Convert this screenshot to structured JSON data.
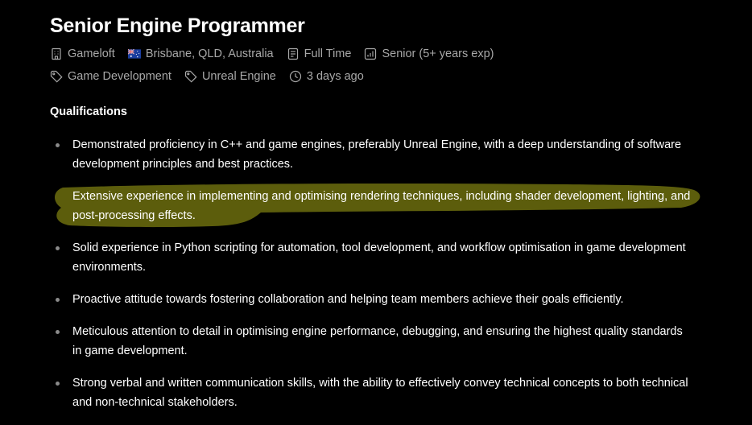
{
  "job": {
    "title": "Senior Engine Programmer",
    "company": "Gameloft",
    "location": "Brisbane, QLD, Australia",
    "employment_type": "Full Time",
    "level": "Senior (5+ years exp)",
    "tags": [
      "Game Development",
      "Unreal Engine"
    ],
    "posted": "3 days ago"
  },
  "icons": {
    "company": "building-icon",
    "location": "australia-flag-icon",
    "employment_type": "document-icon",
    "level": "bar-chart-icon",
    "tag": "tag-icon",
    "posted": "clock-icon"
  },
  "qualifications": {
    "heading": "Qualifications",
    "items": [
      "Demonstrated proficiency in C++ and game engines, preferably Unreal Engine, with a deep understanding of software development principles and best practices.",
      "Extensive experience in implementing and optimising rendering techniques, including shader development, lighting, and post-processing effects.",
      "Solid experience in Python scripting for automation, tool development, and workflow optimisation in game development environments.",
      "Proactive attitude towards fostering collaboration and helping team members achieve their goals efficiently.",
      "Meticulous attention to detail in optimising engine performance, debugging, and ensuring the highest quality standards in game development.",
      "Strong verbal and written communication skills, with the ability to effectively convey technical concepts to both technical and non-technical stakeholders."
    ],
    "highlighted_item": 1
  },
  "colors": {
    "background": "#000000",
    "text": "#ffffff",
    "meta_text": "#a8a8a8",
    "bullet": "#8a8a8a",
    "highlight": "#5c5d0c"
  }
}
